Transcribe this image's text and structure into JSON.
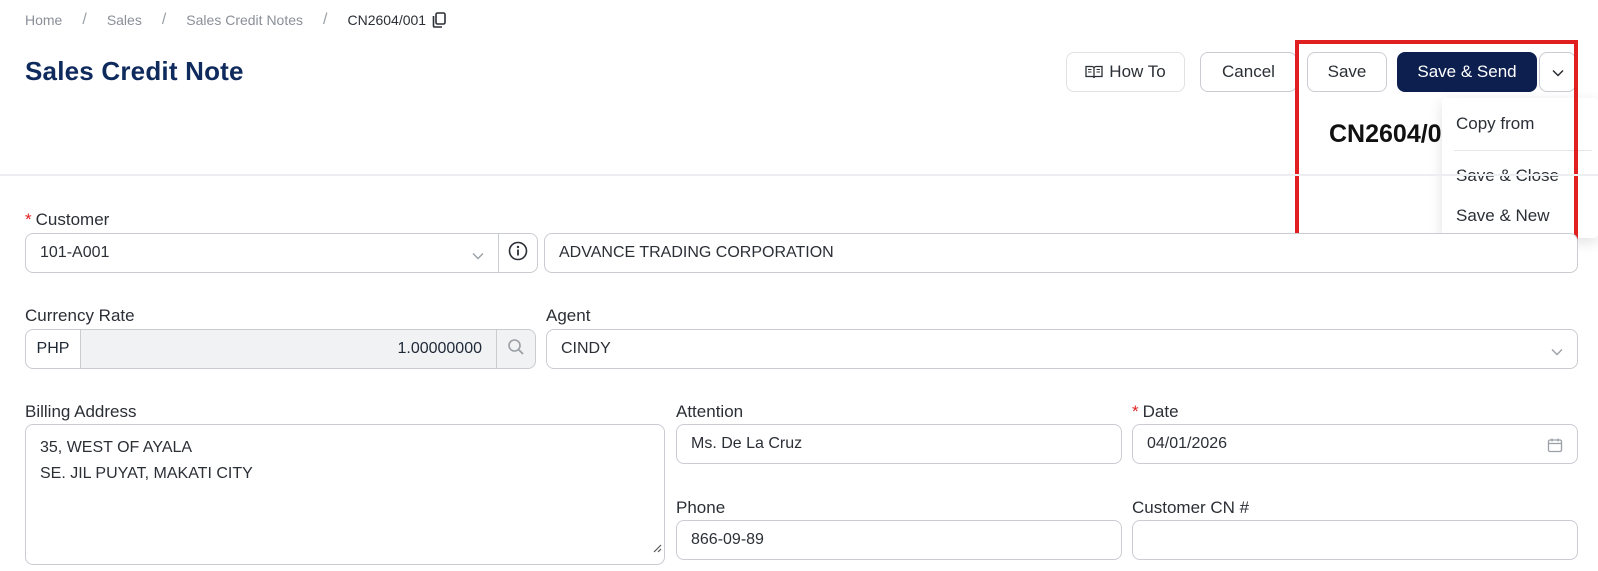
{
  "breadcrumb": {
    "home": "Home",
    "sales": "Sales",
    "credit_notes": "Sales Credit Notes",
    "current": "CN2604/001",
    "separator": "/"
  },
  "page_title": "Sales Credit Note",
  "toolbar": {
    "how_to": "How To",
    "cancel": "Cancel",
    "save": "Save",
    "save_send": "Save & Send"
  },
  "dropdown_menu": {
    "items": [
      "Copy from",
      "Save & Close",
      "Save & New"
    ]
  },
  "document_number_partial": "CN2604/0",
  "form": {
    "customer": {
      "label": "Customer",
      "code": "101-A001",
      "name": "ADVANCE TRADING CORPORATION"
    },
    "currency_rate": {
      "label": "Currency Rate",
      "code": "PHP",
      "rate": "1.00000000"
    },
    "agent": {
      "label": "Agent",
      "value": "CINDY"
    },
    "billing_address": {
      "label": "Billing Address",
      "line1": "35, WEST OF AYALA",
      "line2": "SE. JIL PUYAT, MAKATI CITY"
    },
    "attention": {
      "label": "Attention",
      "value": "Ms. De La Cruz"
    },
    "date": {
      "label": "Date",
      "value": "04/01/2026"
    },
    "phone": {
      "label": "Phone",
      "value": "866-09-89"
    },
    "customer_cn": {
      "label": "Customer CN #",
      "value": ""
    }
  },
  "colors": {
    "primary": "#0d1f4f",
    "title": "#0f2a5c",
    "required": "#e02020",
    "highlight": "#e02020"
  }
}
